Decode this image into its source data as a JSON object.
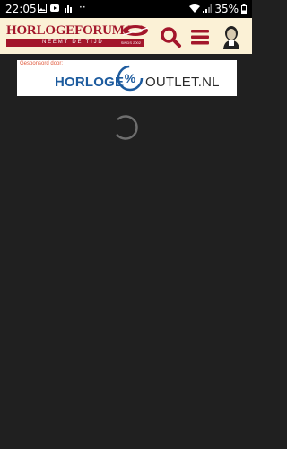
{
  "status_bar": {
    "time": "22:05",
    "dots": "··",
    "battery_percent": "35%",
    "icons": [
      "image-icon",
      "youtube-icon",
      "chart-icon",
      "wifi-icon",
      "signal-icon",
      "battery-icon"
    ]
  },
  "header": {
    "logo_text": "HORLOGEFORUM.NL",
    "logo_tagline": "NEEMT DE TIJD",
    "logo_since": "SINDS 2002",
    "search_icon": "search-icon",
    "menu_icon": "menu-icon",
    "avatar_icon": "avatar-icon",
    "brand_color": "#a3162b"
  },
  "sponsor": {
    "label": "Gesponsord door:",
    "brand_left": "HORLOGE",
    "brand_right": "OUTLET.NL",
    "brand_color": "#1d5b9e"
  },
  "content": {
    "loading_indicator": "loading-spinner"
  }
}
